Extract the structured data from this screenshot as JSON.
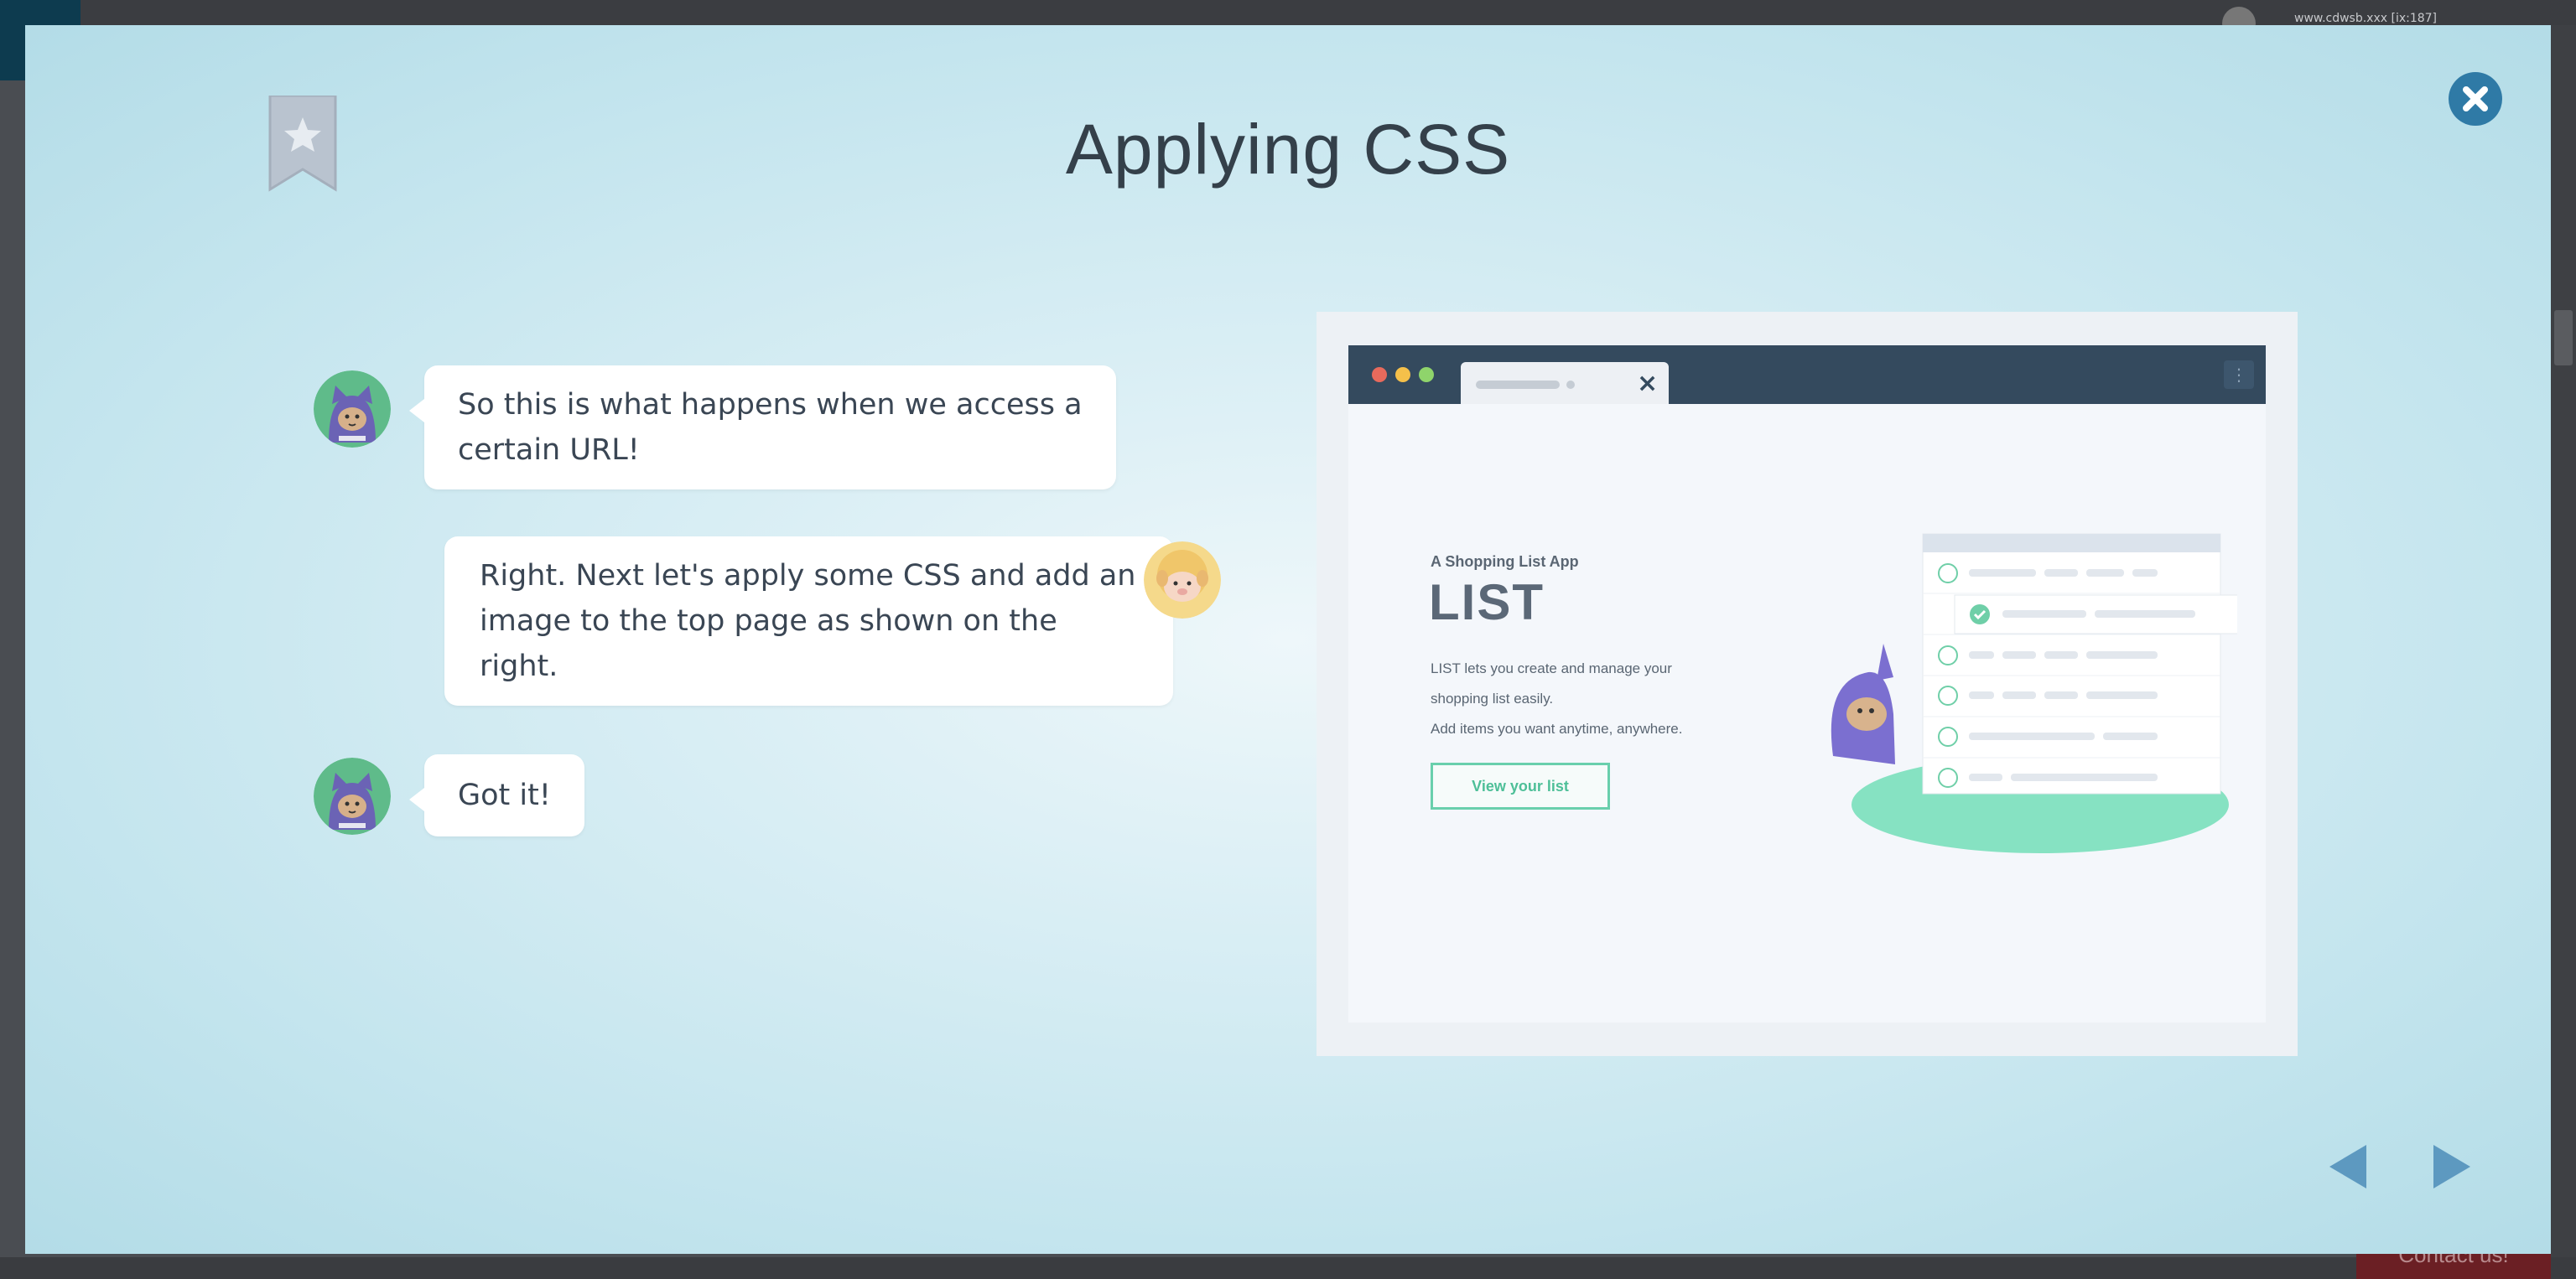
{
  "background": {
    "url_text": "www.cdwsb.xxx [ix:187]",
    "contact_label": "Contact us!"
  },
  "modal": {
    "title": "Applying CSS",
    "bookmark_icon": "star-bookmark-icon",
    "close_icon": "close-icon"
  },
  "chat": [
    {
      "speaker": "cat-ninja",
      "side": "left",
      "lines": [
        "So this is what happens when we access a",
        "certain URL!"
      ]
    },
    {
      "speaker": "sheep",
      "side": "right",
      "lines": [
        "Right. Next let's apply some CSS and add an",
        "image to the top page as shown on the",
        "right."
      ]
    },
    {
      "speaker": "cat-ninja",
      "side": "left",
      "lines": [
        "Got it!"
      ]
    }
  ],
  "preview": {
    "app_subtitle": "A Shopping List App",
    "app_title": "LIST",
    "description": [
      "LIST lets you create and manage your",
      "shopping list easily.",
      "Add items you want anytime, anywhere."
    ],
    "button_label": "View your list",
    "window_dots": [
      "#e86a5c",
      "#f5c04a",
      "#8fd46b"
    ],
    "accent_color": "#69cfac"
  },
  "navigation": {
    "prev_icon": "left-arrow-icon",
    "next_icon": "right-arrow-icon"
  }
}
